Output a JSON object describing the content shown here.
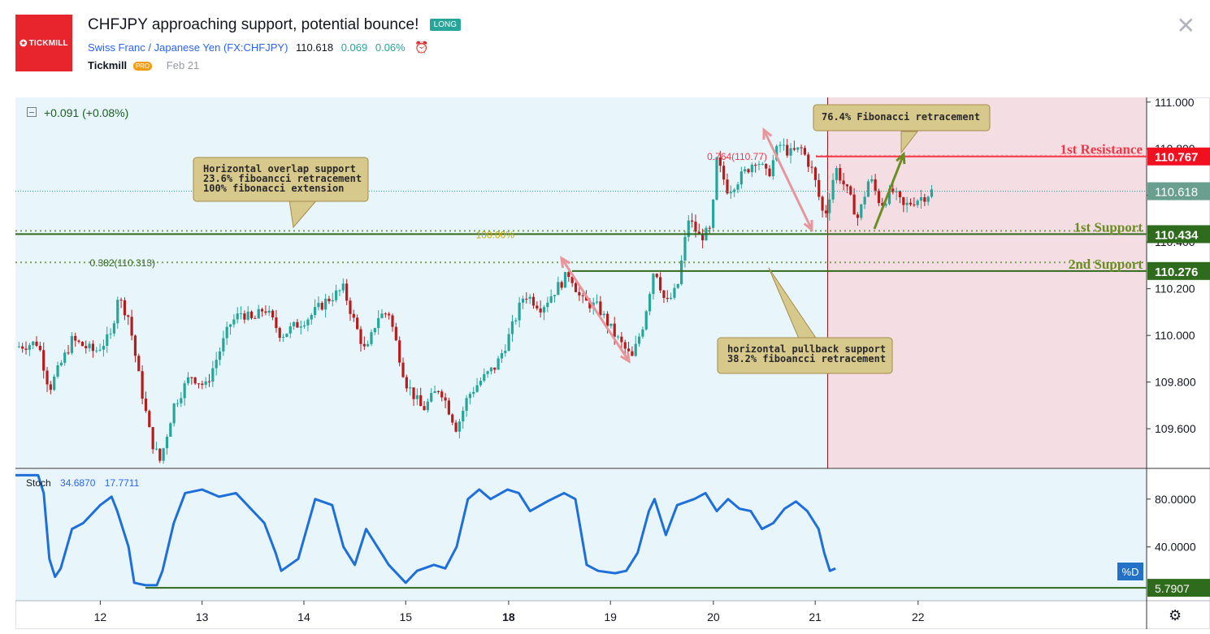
{
  "header": {
    "logo_text": "TICKMILL",
    "title": "CHFJPY approaching support, potential bounce!",
    "badge": "LONG",
    "symbol_name": "Swiss Franc / Japanese Yen",
    "ticker": "(FX:CHFJPY)",
    "price": "110.618",
    "change": "0.069",
    "change_pct": "0.06%",
    "author": "Tickmill",
    "author_badge": "PRO",
    "date": "Feb 21",
    "close_icon": "close-icon",
    "alarm_icon": "alarm-clock-icon"
  },
  "colors": {
    "up": "#26a69a",
    "down": "#b71c1c",
    "resistance": "#f23645",
    "support": "#33691e",
    "stoch": "#1e6fd9",
    "chart_bg": "#e8f6fc",
    "forecast_bg": "#f5dde4",
    "callout": "#d7c88c"
  },
  "legend": {
    "change": "+0.091 (+0.08%)",
    "stoch_label": "Stoch",
    "stoch_k": "34.6870",
    "stoch_d": "17.7711",
    "percent_d_tag": "%D"
  },
  "chart_data": {
    "type": "candlestick",
    "symbol": "CHFJPY",
    "ylim": [
      109.43,
      111.02
    ],
    "yticks": [
      "111.000",
      "110.800",
      "110.600",
      "110.400",
      "110.200",
      "110.000",
      "109.800",
      "109.600"
    ],
    "xticks": [
      {
        "label": "12",
        "pos": 0.075
      },
      {
        "label": "13",
        "pos": 0.165
      },
      {
        "label": "14",
        "pos": 0.255
      },
      {
        "label": "15",
        "pos": 0.345
      },
      {
        "label": "18",
        "pos": 0.436,
        "bold": true
      },
      {
        "label": "19",
        "pos": 0.526
      },
      {
        "label": "20",
        "pos": 0.617
      },
      {
        "label": "21",
        "pos": 0.707
      },
      {
        "label": "22",
        "pos": 0.798
      }
    ],
    "current_price": 110.618,
    "price_path": [
      {
        "t": 0.0,
        "p": 109.95
      },
      {
        "t": 0.02,
        "p": 109.97
      },
      {
        "t": 0.03,
        "p": 109.77
      },
      {
        "t": 0.05,
        "p": 109.98
      },
      {
        "t": 0.07,
        "p": 109.93
      },
      {
        "t": 0.085,
        "p": 110.0
      },
      {
        "t": 0.09,
        "p": 110.17
      },
      {
        "t": 0.1,
        "p": 110.08
      },
      {
        "t": 0.11,
        "p": 109.8
      },
      {
        "t": 0.12,
        "p": 109.55
      },
      {
        "t": 0.128,
        "p": 109.46
      },
      {
        "t": 0.14,
        "p": 109.7
      },
      {
        "t": 0.155,
        "p": 109.83
      },
      {
        "t": 0.168,
        "p": 109.78
      },
      {
        "t": 0.19,
        "p": 110.05
      },
      {
        "t": 0.2,
        "p": 110.1
      },
      {
        "t": 0.21,
        "p": 110.06
      },
      {
        "t": 0.22,
        "p": 110.12
      },
      {
        "t": 0.235,
        "p": 110.0
      },
      {
        "t": 0.25,
        "p": 110.05
      },
      {
        "t": 0.26,
        "p": 110.08
      },
      {
        "t": 0.275,
        "p": 110.15
      },
      {
        "t": 0.29,
        "p": 110.2
      },
      {
        "t": 0.3,
        "p": 110.05
      },
      {
        "t": 0.31,
        "p": 109.92
      },
      {
        "t": 0.32,
        "p": 110.08
      },
      {
        "t": 0.33,
        "p": 110.1
      },
      {
        "t": 0.345,
        "p": 109.8
      },
      {
        "t": 0.36,
        "p": 109.68
      },
      {
        "t": 0.375,
        "p": 109.78
      },
      {
        "t": 0.39,
        "p": 109.6
      },
      {
        "t": 0.4,
        "p": 109.74
      },
      {
        "t": 0.41,
        "p": 109.8
      },
      {
        "t": 0.425,
        "p": 109.87
      },
      {
        "t": 0.435,
        "p": 109.98
      },
      {
        "t": 0.45,
        "p": 110.18
      },
      {
        "t": 0.465,
        "p": 110.12
      },
      {
        "t": 0.478,
        "p": 110.2
      },
      {
        "t": 0.49,
        "p": 110.27
      },
      {
        "t": 0.5,
        "p": 110.15
      },
      {
        "t": 0.515,
        "p": 110.12
      },
      {
        "t": 0.53,
        "p": 110.0
      },
      {
        "t": 0.545,
        "p": 109.9
      },
      {
        "t": 0.555,
        "p": 110.05
      },
      {
        "t": 0.565,
        "p": 110.3
      },
      {
        "t": 0.575,
        "p": 110.13
      },
      {
        "t": 0.585,
        "p": 110.2
      },
      {
        "t": 0.595,
        "p": 110.5
      },
      {
        "t": 0.605,
        "p": 110.42
      },
      {
        "t": 0.615,
        "p": 110.45
      },
      {
        "t": 0.62,
        "p": 110.75
      },
      {
        "t": 0.63,
        "p": 110.62
      },
      {
        "t": 0.645,
        "p": 110.7
      },
      {
        "t": 0.655,
        "p": 110.76
      },
      {
        "t": 0.665,
        "p": 110.68
      },
      {
        "t": 0.675,
        "p": 110.82
      },
      {
        "t": 0.685,
        "p": 110.78
      },
      {
        "t": 0.695,
        "p": 110.8
      },
      {
        "t": 0.705,
        "p": 110.7
      },
      {
        "t": 0.715,
        "p": 110.5
      },
      {
        "t": 0.725,
        "p": 110.72
      },
      {
        "t": 0.735,
        "p": 110.62
      },
      {
        "t": 0.745,
        "p": 110.5
      },
      {
        "t": 0.755,
        "p": 110.68
      },
      {
        "t": 0.765,
        "p": 110.56
      },
      {
        "t": 0.775,
        "p": 110.62
      },
      {
        "t": 0.785,
        "p": 110.55
      },
      {
        "t": 0.795,
        "p": 110.58
      },
      {
        "t": 0.805,
        "p": 110.6
      },
      {
        "t": 0.81,
        "p": 110.618
      }
    ],
    "levels": [
      {
        "name": "1st Resistance",
        "value": 110.767,
        "tag": "110.767",
        "color": "#f23645",
        "style": "solid"
      },
      {
        "name": "1st Support",
        "value": 110.434,
        "tag": "110.434",
        "color": "#33691e",
        "style": "solid"
      },
      {
        "name": "2nd Support",
        "value": 110.276,
        "tag": "110.276",
        "color": "#33691e",
        "style": "solid"
      }
    ],
    "fib_labels": [
      {
        "text": "0.764(110.77)",
        "value": 110.77,
        "color": "#f23645"
      },
      {
        "text": "100.00%",
        "value": 110.434,
        "color": "#c8a800"
      },
      {
        "text": "0.382(110.313)",
        "value": 110.313,
        "color": "#33691e"
      }
    ],
    "price_tag": "110.618",
    "annotations": [
      {
        "lines": [
          "Horizontal overlap support",
          "23.6% fiboancci retracement",
          "100% fibonacci extension"
        ]
      },
      {
        "lines": [
          "76.4% Fibonacci retracement"
        ]
      },
      {
        "lines": [
          "horizontal pullback support",
          "38.2% fiboancci retracement"
        ]
      }
    ],
    "stochastic": {
      "ylim": [
        -5,
        105
      ],
      "yticks": [
        "80.0000",
        "40.0000"
      ],
      "level": 5.7907,
      "level_tag": "5.7907",
      "k_path": [
        [
          0.0,
          100
        ],
        [
          0.02,
          100
        ],
        [
          0.025,
          85
        ],
        [
          0.03,
          30
        ],
        [
          0.035,
          15
        ],
        [
          0.04,
          22
        ],
        [
          0.05,
          55
        ],
        [
          0.06,
          60
        ],
        [
          0.075,
          75
        ],
        [
          0.085,
          82
        ],
        [
          0.09,
          70
        ],
        [
          0.1,
          40
        ],
        [
          0.105,
          10
        ],
        [
          0.115,
          8
        ],
        [
          0.125,
          8
        ],
        [
          0.13,
          20
        ],
        [
          0.14,
          60
        ],
        [
          0.15,
          85
        ],
        [
          0.165,
          88
        ],
        [
          0.18,
          82
        ],
        [
          0.195,
          85
        ],
        [
          0.21,
          70
        ],
        [
          0.22,
          60
        ],
        [
          0.23,
          35
        ],
        [
          0.235,
          20
        ],
        [
          0.25,
          30
        ],
        [
          0.265,
          80
        ],
        [
          0.28,
          75
        ],
        [
          0.29,
          40
        ],
        [
          0.3,
          25
        ],
        [
          0.31,
          55
        ],
        [
          0.32,
          40
        ],
        [
          0.33,
          25
        ],
        [
          0.345,
          10
        ],
        [
          0.355,
          20
        ],
        [
          0.37,
          25
        ],
        [
          0.38,
          22
        ],
        [
          0.39,
          40
        ],
        [
          0.4,
          80
        ],
        [
          0.41,
          88
        ],
        [
          0.42,
          80
        ],
        [
          0.435,
          88
        ],
        [
          0.445,
          85
        ],
        [
          0.455,
          70
        ],
        [
          0.47,
          78
        ],
        [
          0.485,
          85
        ],
        [
          0.495,
          80
        ],
        [
          0.505,
          25
        ],
        [
          0.515,
          20
        ],
        [
          0.53,
          18
        ],
        [
          0.54,
          20
        ],
        [
          0.55,
          35
        ],
        [
          0.56,
          70
        ],
        [
          0.565,
          80
        ],
        [
          0.575,
          50
        ],
        [
          0.585,
          75
        ],
        [
          0.6,
          80
        ],
        [
          0.61,
          85
        ],
        [
          0.62,
          70
        ],
        [
          0.63,
          80
        ],
        [
          0.64,
          72
        ],
        [
          0.65,
          70
        ],
        [
          0.66,
          55
        ],
        [
          0.67,
          60
        ],
        [
          0.68,
          72
        ],
        [
          0.69,
          78
        ],
        [
          0.7,
          70
        ],
        [
          0.71,
          55
        ],
        [
          0.715,
          35
        ],
        [
          0.72,
          20
        ],
        [
          0.725,
          22
        ]
      ]
    }
  }
}
